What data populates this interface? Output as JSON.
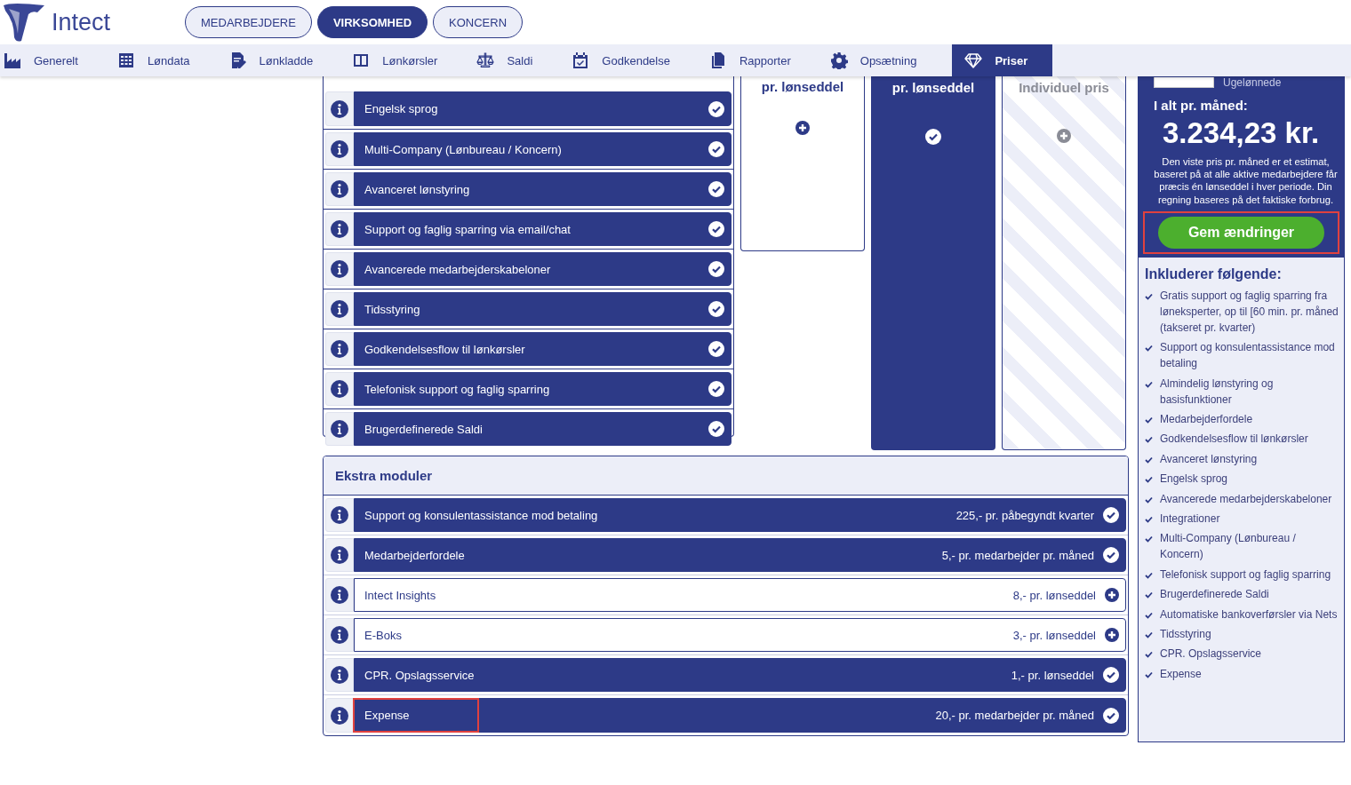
{
  "logo": {
    "name": "Intect"
  },
  "scopes": [
    {
      "label": "MEDARBEJDERE",
      "selected": false
    },
    {
      "label": "VIRKSOMHED",
      "selected": true
    },
    {
      "label": "KONCERN",
      "selected": false
    }
  ],
  "nav": [
    {
      "label": "Generelt",
      "selected": false
    },
    {
      "label": "Løndata",
      "selected": false
    },
    {
      "label": "Lønkladde",
      "selected": false
    },
    {
      "label": "Lønkørsler",
      "selected": false
    },
    {
      "label": "Saldi",
      "selected": false
    },
    {
      "label": "Godkendelse",
      "selected": false
    },
    {
      "label": "Rapporter",
      "selected": false
    },
    {
      "label": "Opsætning",
      "selected": false
    },
    {
      "label": "Priser",
      "selected": true
    }
  ],
  "features": [
    {
      "label": "Engelsk sprog",
      "included": true
    },
    {
      "label": "Multi-Company (Lønbureau / Koncern)",
      "included": true
    },
    {
      "label": "Avanceret lønstyring",
      "included": true
    },
    {
      "label": "Support og faglig sparring via email/chat",
      "included": true
    },
    {
      "label": "Avancerede medarbejderskabeloner",
      "included": true
    },
    {
      "label": "Tidsstyring",
      "included": true
    },
    {
      "label": "Godkendelsesflow til lønkørsler",
      "included": true
    },
    {
      "label": "Telefonisk support og faglig sparring",
      "included": true
    },
    {
      "label": "Brugerdefinerede Saldi",
      "included": true
    }
  ],
  "plans": [
    {
      "title": "pr. lønseddel",
      "kind": "outlined",
      "selected": false
    },
    {
      "title": "pr. lønseddel",
      "kind": "filled",
      "selected": true
    },
    {
      "title": "Individuel pris",
      "kind": "striped",
      "selected": false
    }
  ],
  "extras": {
    "title": "Ekstra moduler",
    "items": [
      {
        "label": "Support og konsulentassistance mod betaling",
        "price": "225,- pr. påbegyndt kvarter",
        "selected": true,
        "highlighted": false
      },
      {
        "label": "Medarbejderfordele",
        "price": "5,- pr. medarbejder pr. måned",
        "selected": true,
        "highlighted": false
      },
      {
        "label": "Intect Insights",
        "price": "8,- pr. lønseddel",
        "selected": false,
        "highlighted": false
      },
      {
        "label": "E-Boks",
        "price": "3,- pr. lønseddel",
        "selected": false,
        "highlighted": false
      },
      {
        "label": "CPR. Opslagsservice",
        "price": "1,- pr. lønseddel",
        "selected": true,
        "highlighted": false
      },
      {
        "label": "Expense",
        "price": "20,- pr. medarbejder pr. måned",
        "selected": true,
        "highlighted": true
      }
    ]
  },
  "summary": {
    "option": {
      "label": "Ugelønnede",
      "checked": false
    },
    "total_label": "I alt pr. måned:",
    "total": "3.234,23 kr.",
    "note": "Den viste pris pr. måned er et estimat, baseret på at alle aktive medarbejdere får præcis én lønseddel i hver periode. Din regning baseres på det faktiske forbrug.",
    "save_button": {
      "label": "Gem ændringer",
      "highlighted": true
    },
    "included_title": "Inkluderer følgende:",
    "included": [
      "Gratis support og faglig sparring fra løneksperter, op til [60 min. pr. måned (takseret pr. kvarter)",
      "Support og konsulentassistance mod betaling",
      "Almindelig lønstyring og basisfunktioner",
      "Medarbejderfordele",
      "Godkendelsesflow til lønkørsler",
      "Avanceret lønstyring",
      "Engelsk sprog",
      "Avancerede medarbejderskabeloner",
      "Integrationer",
      "Multi-Company (Lønbureau / Koncern)",
      "Telefonisk support og faglig sparring",
      "Brugerdefinerede Saldi",
      "Automatiske bankoverførsler via Nets",
      "Tidsstyring",
      "CPR. Opslagsservice",
      "Expense"
    ]
  }
}
